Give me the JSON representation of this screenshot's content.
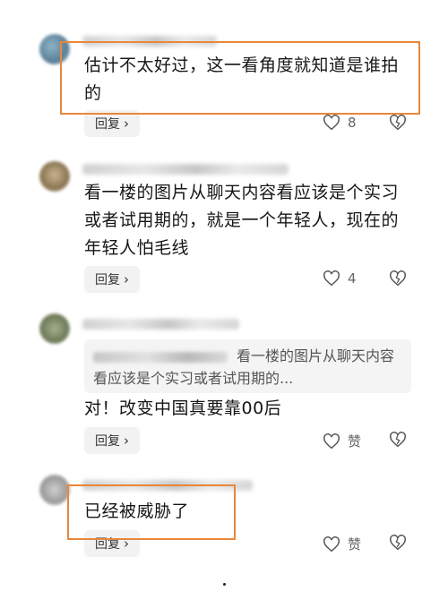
{
  "comments": [
    {
      "text": "估计不太好过，这一看角度就知道是谁拍的",
      "reply_label": "回复",
      "like_value": "8"
    },
    {
      "text": "看一楼的图片从聊天内容看应该是个实习或者试用期的，就是一个年轻人，现在的年轻人怕毛线",
      "reply_label": "回复",
      "like_value": "4"
    },
    {
      "quote": "看一楼的图片从聊天内容看应该是个实习或者试用期的...",
      "text": "对！改变中国真要靠00后",
      "reply_label": "回复",
      "like_value": "赞"
    },
    {
      "text": "已经被威胁了",
      "reply_label": "回复",
      "like_value": "赞"
    }
  ],
  "icons": {
    "heart": "heart-icon",
    "dislike": "broken-heart-icon",
    "chevron": "chevron-right-icon"
  },
  "colors": {
    "highlight": "#e8873a",
    "button_bg": "#f2f2f2",
    "quote_bg": "#f4f4f4"
  }
}
